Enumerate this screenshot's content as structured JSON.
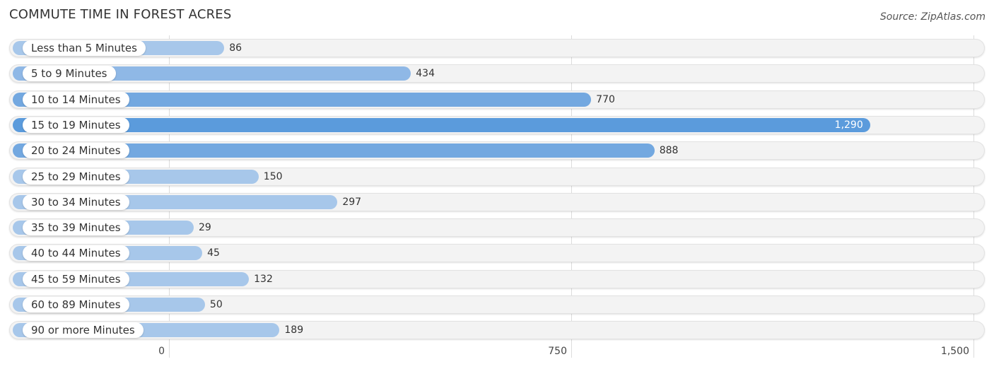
{
  "chart_data": {
    "type": "bar",
    "orientation": "horizontal",
    "title": "COMMUTE TIME IN FOREST ACRES",
    "source": "Source: ZipAtlas.com",
    "categories": [
      "Less than 5 Minutes",
      "5 to 9 Minutes",
      "10 to 14 Minutes",
      "15 to 19 Minutes",
      "20 to 24 Minutes",
      "25 to 29 Minutes",
      "30 to 34 Minutes",
      "35 to 39 Minutes",
      "40 to 44 Minutes",
      "45 to 59 Minutes",
      "60 to 89 Minutes",
      "90 or more Minutes"
    ],
    "values": [
      86,
      434,
      770,
      1290,
      888,
      150,
      297,
      29,
      45,
      132,
      50,
      189
    ],
    "value_labels": [
      "86",
      "434",
      "770",
      "1,290",
      "888",
      "150",
      "297",
      "29",
      "45",
      "132",
      "50",
      "189"
    ],
    "xlim": [
      0,
      1500
    ],
    "xticks": [
      0,
      750,
      1500
    ],
    "xtick_labels": [
      "0",
      "750",
      "1,500"
    ],
    "grid": true,
    "xlabel": "",
    "ylabel": "",
    "colors": {
      "max": "#5b9bdc",
      "high": "#73a8e0",
      "low": "#a7c7ea"
    }
  }
}
